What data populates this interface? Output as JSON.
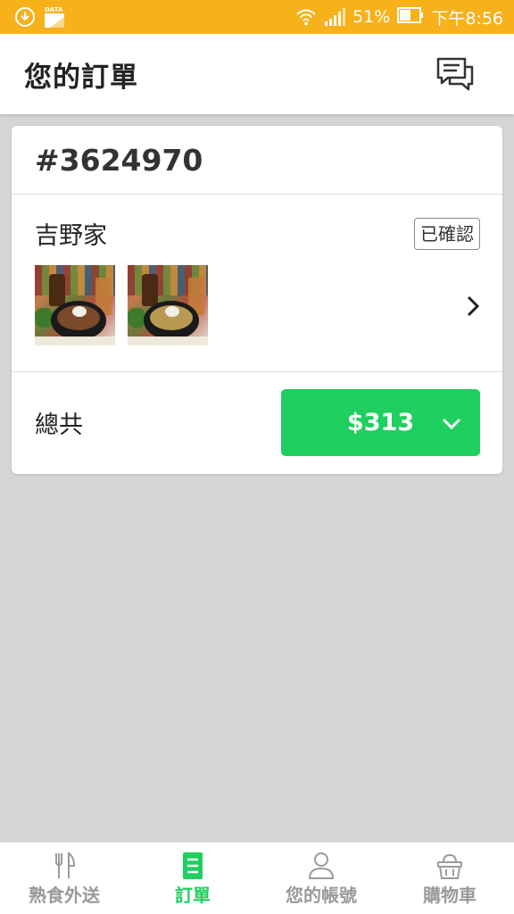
{
  "status_bar": {
    "data_label": "DATA",
    "battery": "51%",
    "time": "下午8:56"
  },
  "header": {
    "title": "您的訂單"
  },
  "order": {
    "number": "#3624970",
    "restaurant": "吉野家",
    "status": "已確認",
    "total_label": "總共",
    "total_amount": "$313"
  },
  "bottom_nav": {
    "items": [
      {
        "label": "熟食外送",
        "icon": "fork-knife-icon",
        "active": false
      },
      {
        "label": "訂單",
        "icon": "order-list-icon",
        "active": true
      },
      {
        "label": "您的帳號",
        "icon": "user-icon",
        "active": false
      },
      {
        "label": "購物車",
        "icon": "basket-icon",
        "active": false
      }
    ]
  },
  "colors": {
    "status_bar": "#f6b11b",
    "accent_green": "#1fcf5f",
    "background": "#d6d6d6"
  }
}
